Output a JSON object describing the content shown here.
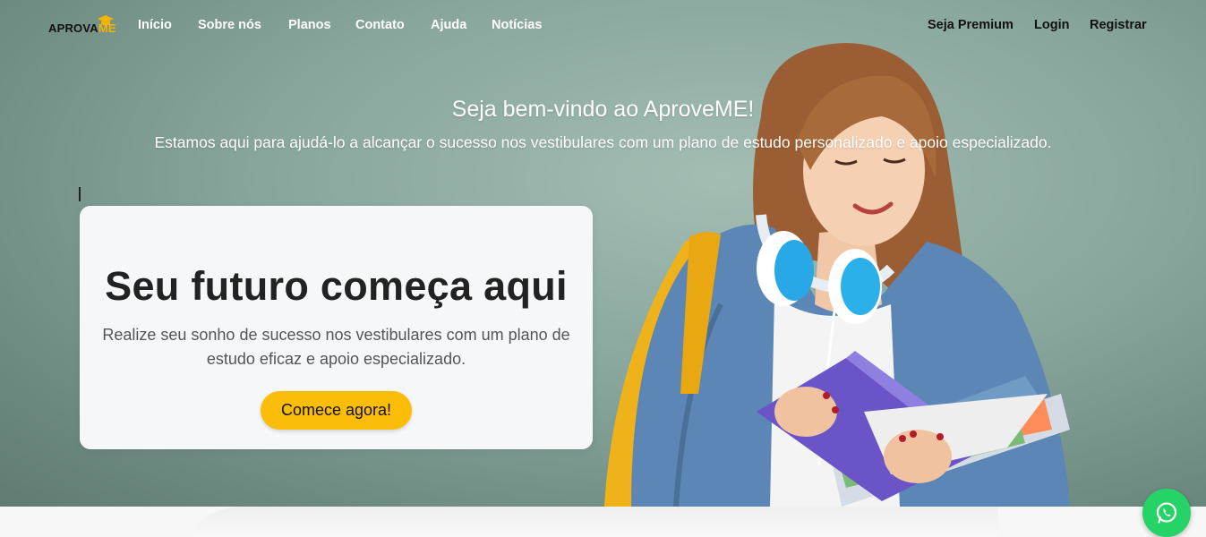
{
  "brand": {
    "logo_main": "APROVA",
    "logo_accent": "ME"
  },
  "nav": {
    "links": [
      "Início",
      "Sobre nós",
      "Planos",
      "Contato",
      "Ajuda",
      "Notícias"
    ],
    "right": [
      "Seja Premium",
      "Login",
      "Registrar"
    ]
  },
  "hero": {
    "title": "Seja bem-vindo ao AproveME!",
    "subtitle": "Estamos aqui para ajudá-lo a alcançar o sucesso nos vestibulares com um plano de estudo personalizado e apoio especializado."
  },
  "card": {
    "title": "Seu futuro começa aqui",
    "text": "Realize seu sonho de sucesso nos vestibulares com um plano de estudo eficaz e apoio especializado.",
    "cta": "Comece agora!"
  },
  "colors": {
    "accent": "#fbbd08",
    "whatsapp": "#25d366",
    "hero_bg": "#88a69c"
  },
  "icons": {
    "chat": "whatsapp-icon",
    "logo": "graduation-cap-icon"
  }
}
